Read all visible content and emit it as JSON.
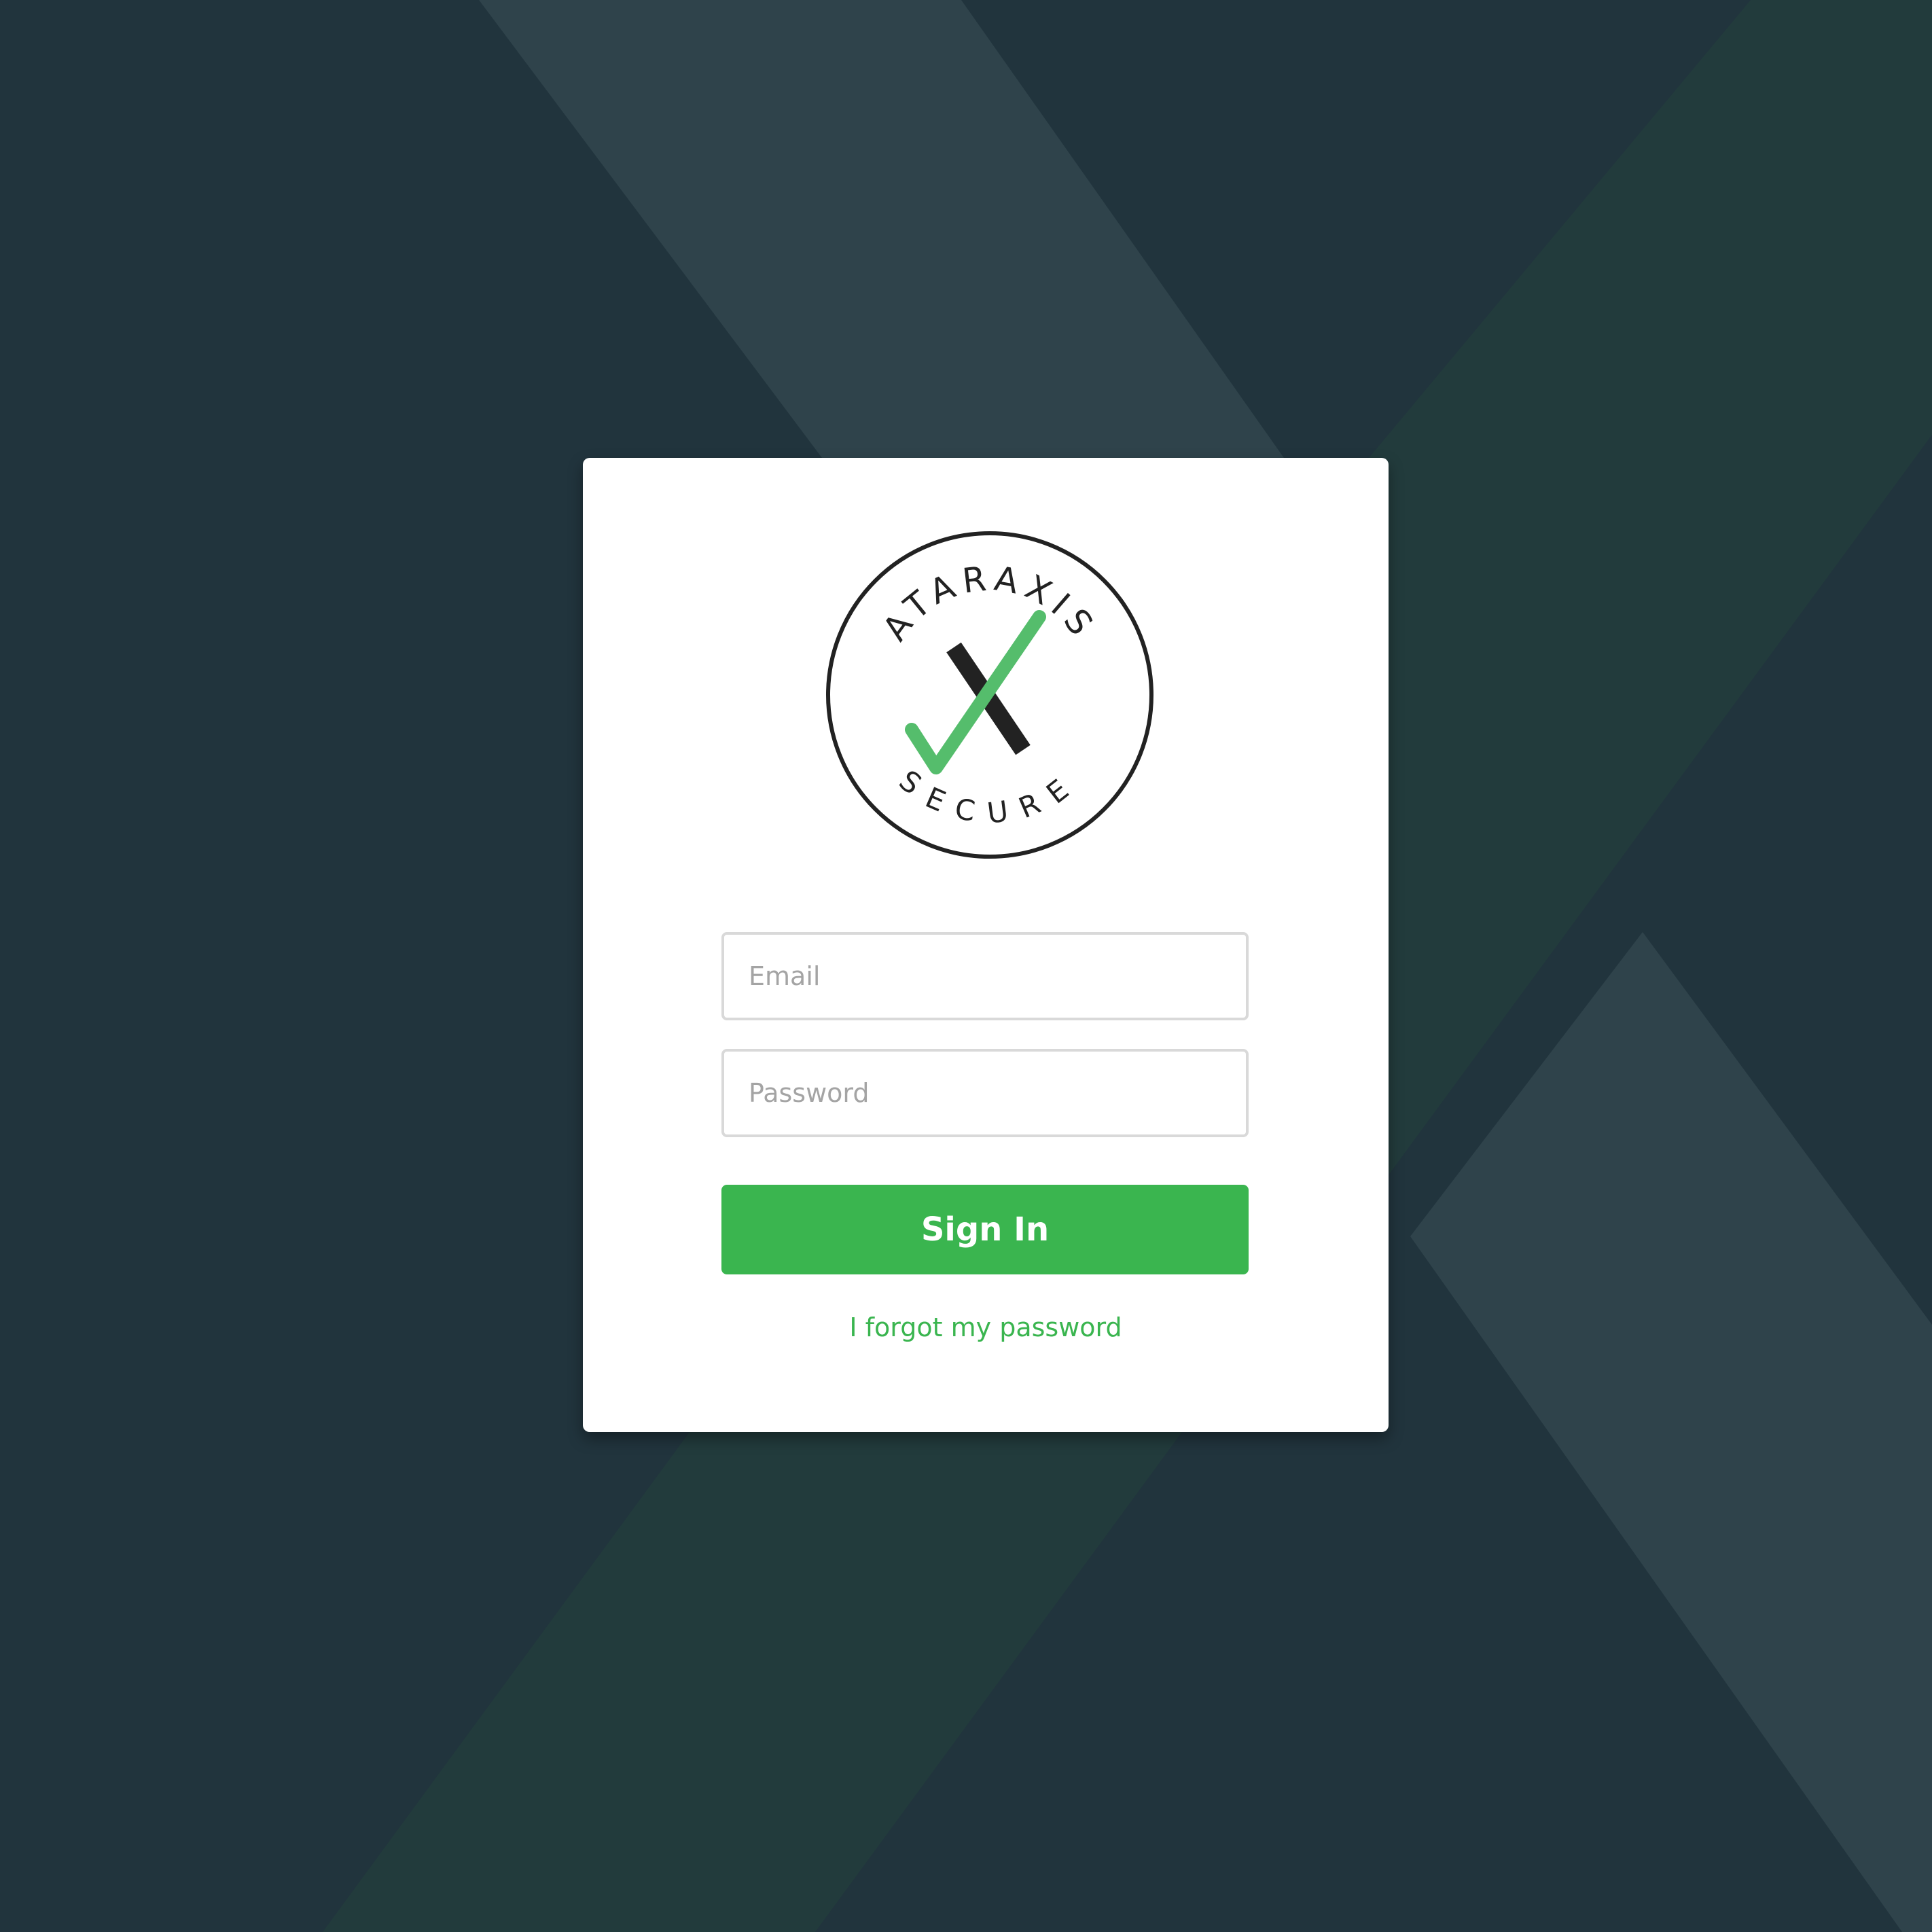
{
  "brand": {
    "logo_top_text": "ATARAXIS",
    "logo_bottom_text": "SECURE",
    "icon": "ataraxis-secure-logo-icon"
  },
  "login_form": {
    "email_placeholder": "Email",
    "email_value": "",
    "password_placeholder": "Password",
    "password_value": "",
    "sign_in_label": "Sign In",
    "forgot_password_label": "I forgot my password"
  },
  "colors": {
    "background": "#21343d",
    "background_stripe_light": "#2f434b",
    "background_stripe_green": "#223b3c",
    "accent_green": "#3ab54f",
    "logo_check_green": "#55bd6c",
    "logo_dark": "#222222",
    "card": "#ffffff"
  }
}
